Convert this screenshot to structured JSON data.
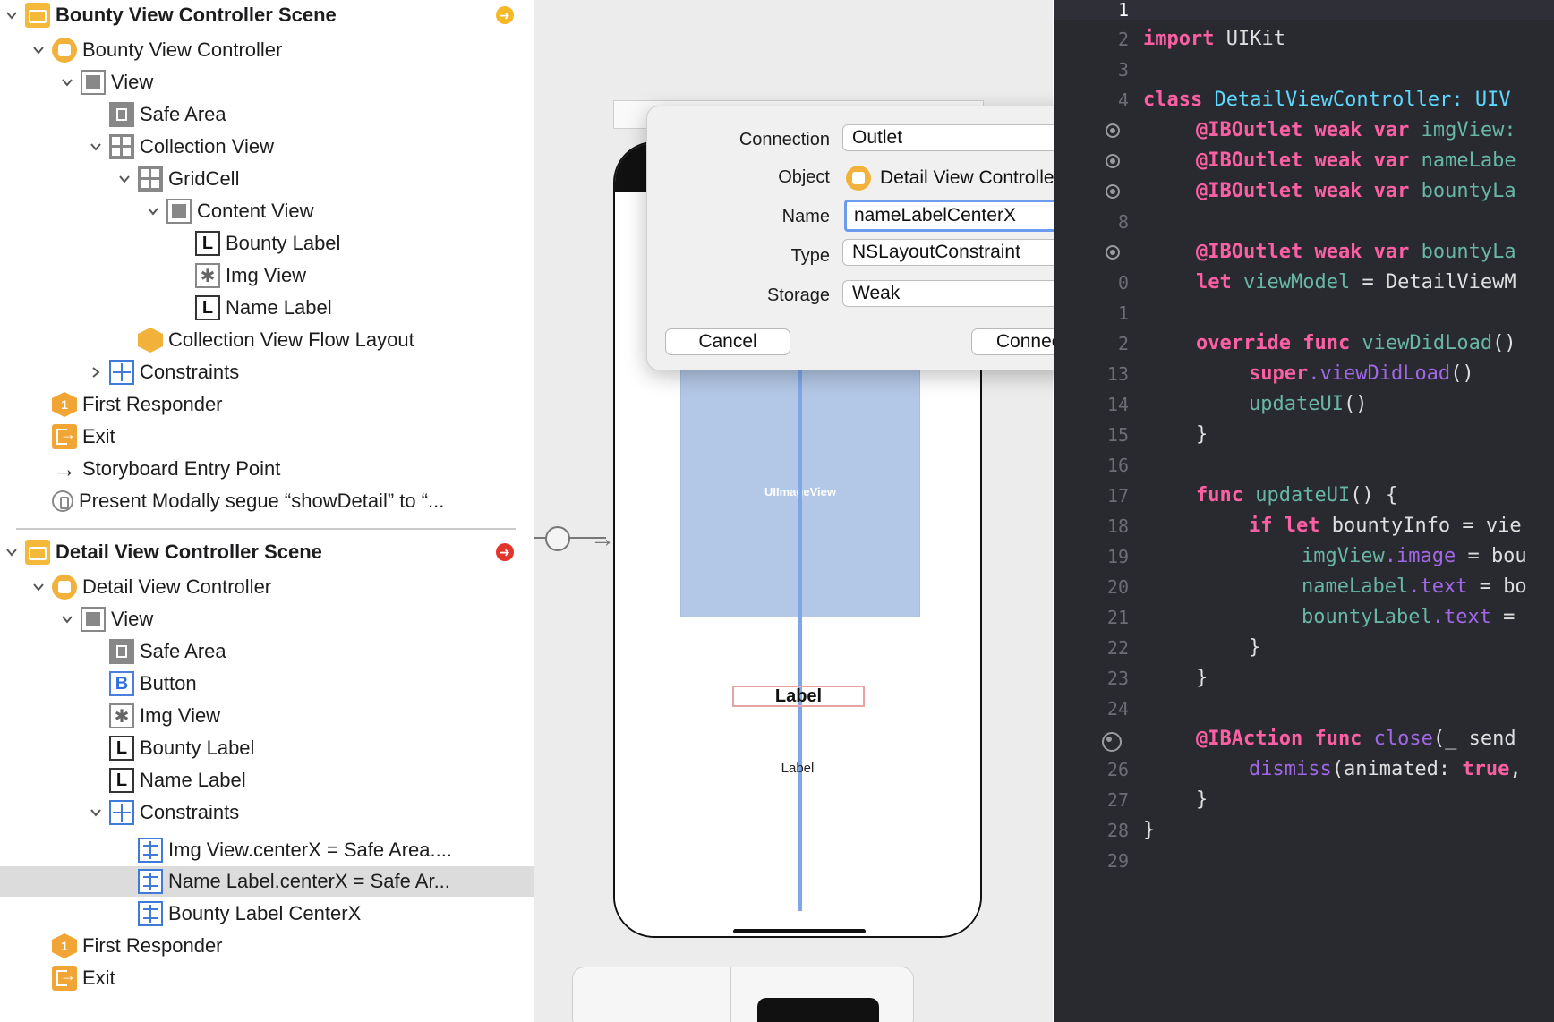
{
  "outline": {
    "scene1_title": "Bounty View Controller Scene",
    "scene1_items": [
      "Bounty View Controller",
      "View",
      "Safe Area",
      "Collection View",
      "GridCell",
      "Content View",
      "Bounty Label",
      "Img View",
      "Name Label",
      "Collection View Flow Layout",
      "Constraints",
      "First Responder",
      "Exit",
      "Storyboard Entry Point",
      "Present Modally segue “showDetail” to “..."
    ],
    "scene2_title": "Detail View Controller Scene",
    "scene2_items": [
      "Detail View Controller",
      "View",
      "Safe Area",
      "Button",
      "Img View",
      "Bounty Label",
      "Name Label",
      "Constraints",
      "Img View.centerX = Safe Area....",
      "Name Label.centerX = Safe Ar...",
      "Bounty Label CenterX",
      "First Responder",
      "Exit"
    ],
    "icon_glyphs": {
      "label": "L",
      "button": "B",
      "image": "✱",
      "first_responder": "1"
    }
  },
  "canvas": {
    "imageview_text": "UIImageView",
    "label_big": "Label",
    "label_small": "Label"
  },
  "dialog": {
    "connection_label": "Connection",
    "connection_value": "Outlet",
    "object_label": "Object",
    "object_value": "Detail View Controller",
    "name_label": "Name",
    "name_value": "nameLabelCenterX",
    "type_label": "Type",
    "type_value": "NSLayoutConstraint",
    "storage_label": "Storage",
    "storage_value": "Weak",
    "cancel": "Cancel",
    "connect": "Connect"
  },
  "editor": {
    "line_numbers": [
      "1",
      "2",
      "3",
      "4",
      "",
      "",
      "",
      "8",
      "",
      "0",
      "1",
      "2",
      "13",
      "14",
      "15",
      "16",
      "17",
      "18",
      "19",
      "20",
      "21",
      "22",
      "23",
      "24",
      "",
      "26",
      "27",
      "28",
      "29"
    ],
    "lines": {
      "l2_kw": "import",
      "l2_rest": " UIKit",
      "l4_kw": "class",
      "l4_type": " DetailViewController: UIV",
      "l5_ann": "@IBOutlet weak var",
      "l5_prop": " imgView:",
      "l6_ann": "@IBOutlet weak var",
      "l6_prop": " nameLabe",
      "l7_ann": "@IBOutlet weak var",
      "l7_prop": " bountyLa",
      "l9_ann": "@IBOutlet weak var",
      "l9_prop": " bountyLa",
      "l10_kw": "let",
      "l10_prop": " viewModel",
      "l10_rest": " = DetailViewM",
      "l12_kw": "override func",
      "l12_fn": " viewDidLoad",
      "l12_rest": "()",
      "l13_kw": "super",
      "l13_call": ".viewDidLoad",
      "l13_rest": "()",
      "l14_fn": "updateUI",
      "l14_rest": "()",
      "brace": "}",
      "l17_kw": "func",
      "l17_fn": " updateUI",
      "l17_rest": "() {",
      "l18_kw": "if let",
      "l18_rest": " bountyInfo = vie",
      "l19_prop": "imgView",
      "l19_call": ".image",
      "l19_rest": " = bou",
      "l20_prop": "nameLabel",
      "l20_call": ".text",
      "l20_rest": " = bo",
      "l21_prop": "bountyLabel",
      "l21_call": ".text",
      "l21_rest": " =",
      "l25_ann": "@IBAction func",
      "l25_fn": " close",
      "l25_rest": "(_ send",
      "l26_call": "dismiss",
      "l26_rest": "(animated: ",
      "l26_kw": "true",
      "l26_end": ","
    }
  }
}
